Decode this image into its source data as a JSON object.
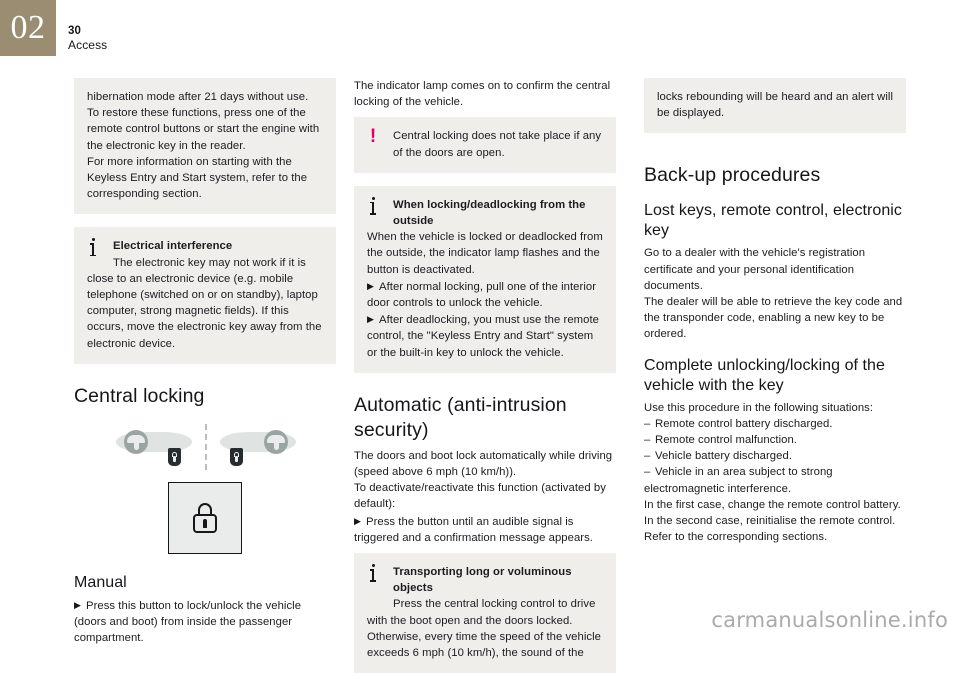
{
  "header": {
    "chapter_number": "02",
    "page_number": "30",
    "section_title": "Access"
  },
  "column1": {
    "continued_box": {
      "p1": "hibernation mode after 21 days without use. To restore these functions, press one of the remote control buttons or start the engine with the electronic key in the reader.",
      "p2": "For more information on starting with the Keyless Entry and Start system, refer to the corresponding section."
    },
    "info_box": {
      "icon": "info-icon",
      "title": "Electrical interference",
      "body": "The electronic key may not work if it is close to an electronic device (e.g. mobile telephone (switched on or on standby), laptop computer, strong magnetic fields). If this occurs, move the electronic key away from the electronic device."
    },
    "heading": "Central locking",
    "figure": {
      "caption_alt": "Left-hand-drive and right-hand-drive dashboard locations of the central locking button",
      "button_icon": "padlock-icon"
    },
    "subheading": "Manual",
    "arrow_glyph": "▶",
    "manual_text": "Press this button to lock/unlock the vehicle (doors and boot) from inside the passenger compartment."
  },
  "column2": {
    "intro": "The indicator lamp comes on to confirm the central locking of the vehicle.",
    "warning_box": {
      "icon": "warning-icon",
      "body": "Central locking does not take place if any of the doors are open."
    },
    "info_box": {
      "icon": "info-icon",
      "title": "When locking/deadlocking from the outside",
      "p1": "When the vehicle is locked or deadlocked from the outside, the indicator lamp flashes and the button is deactivated.",
      "arrow_glyph": "▶",
      "p2": "After normal locking, pull one of the interior door controls to unlock the vehicle.",
      "p3": "After deadlocking, you must use the remote control, the \"Keyless Entry and Start\" system or the built-in key to unlock the vehicle."
    },
    "heading": "Automatic (anti-intrusion security)",
    "p1": "The doors and boot lock automatically while driving (speed above 6 mph (10 km/h)).",
    "p2": "To deactivate/reactivate this function (activated by default):",
    "arrow_glyph": "▶",
    "p3": "Press the button until an audible signal is triggered and a confirmation message appears.",
    "info_box2": {
      "icon": "info-icon",
      "title": "Transporting long or voluminous objects",
      "p1": "Press the central locking control to drive with the boot open and the doors locked.",
      "p2": "Otherwise, every time the speed of the vehicle exceeds 6 mph (10 km/h), the sound of the"
    }
  },
  "column3": {
    "continued_box": "locks rebounding will be heard and an alert will be displayed.",
    "heading": "Back-up procedures",
    "subheading1": "Lost keys, remote control, electronic key",
    "s1_p1": "Go to a dealer with the vehicle's registration certificate and your personal identification documents.",
    "s1_p2": "The dealer will be able to retrieve the key code and the transponder code, enabling a new key to be ordered.",
    "subheading2": "Complete unlocking/locking of the vehicle with the key",
    "s2_intro": "Use this procedure in the following situations:",
    "dash_glyph": "–",
    "s2_list": [
      "Remote control battery discharged.",
      "Remote control malfunction.",
      "Vehicle battery discharged.",
      "Vehicle in an area subject to strong electromagnetic interference."
    ],
    "s2_p1": "In the first case, change the remote control battery.",
    "s2_p2": "In the second case, reinitialise the remote control.",
    "s2_p3": "Refer to the corresponding sections."
  },
  "watermark": "carmanualsonline.info",
  "colors": {
    "chapter_tab": "#9b8d72",
    "callout_bg": "#f0eeea",
    "warning_icon": "#e3005c",
    "text": "#1b1c20"
  }
}
